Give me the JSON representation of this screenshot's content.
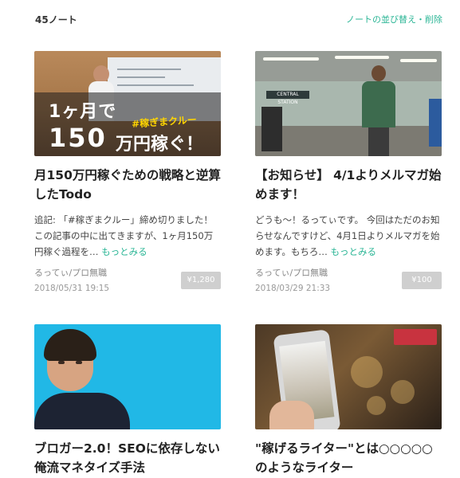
{
  "header": {
    "count": "45ノート",
    "sort_link": "ノートの並び替え・削除"
  },
  "cards": [
    {
      "thumb": {
        "line1": "1ヶ月で",
        "line2": "150",
        "line2b": "万円稼ぐ！",
        "tag": "#稼ぎまクルー"
      },
      "title": "月150万円稼ぐための戦略と逆算したTodo",
      "excerpt": "追記: 「#稼ぎまクルー」締め切りました！この記事の中に出てきますが、1ヶ月150万円稼ぐ過程を…",
      "more": "もっとみる",
      "author": "るってぃ/プロ無職",
      "date": "2018/05/31 19:15",
      "price": "¥1,280"
    },
    {
      "thumb": {
        "sign": "CENTRAL STATION"
      },
      "title": "【お知らせ】 4/1よりメルマガ始めます！",
      "excerpt": "どうも〜！るってぃです。 今回はただのお知らせなんですけど、4月1日よりメルマガを始めます。もちろ…",
      "more": "もっとみる",
      "author": "るってぃ/プロ無職",
      "date": "2018/03/29 21:33",
      "price": "¥100"
    },
    {
      "title": "ブロガー2.0！SEOに依存しない俺流マネタイズ手法"
    },
    {
      "title": "\"稼げるライター\"とは○○○○○のようなライター"
    }
  ],
  "colors": {
    "accent": "#2cb696",
    "price_bg": "#cfcfcf"
  }
}
